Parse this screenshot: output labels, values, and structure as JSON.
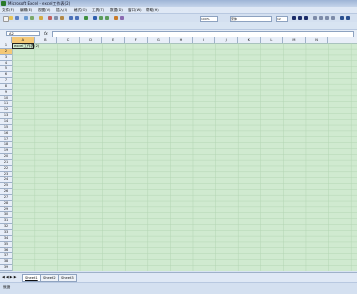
{
  "window": {
    "title": "Microsoft Excel - excel工作表(2)"
  },
  "menu": [
    "文件(F)",
    "编辑(E)",
    "视图(V)",
    "插入(I)",
    "格式(O)",
    "工具(T)",
    "数据(D)",
    "窗口(W)",
    "帮助(H)"
  ],
  "toolbar": {
    "zoom": "100%",
    "font": "宋体",
    "font_size": "12"
  },
  "formula_bar": {
    "name_box": "A2",
    "fx": "fx"
  },
  "columns": [
    "A",
    "B",
    "C",
    "D",
    "E",
    "F",
    "G",
    "H",
    "I",
    "J",
    "K",
    "L",
    "M",
    "N"
  ],
  "rows": [
    "1",
    "2",
    "3",
    "4",
    "5",
    "6",
    "7",
    "8",
    "9",
    "10",
    "11",
    "12",
    "13",
    "14",
    "15",
    "16",
    "17",
    "18",
    "19",
    "20",
    "21",
    "22",
    "23",
    "24",
    "25",
    "26",
    "27",
    "28",
    "29",
    "30",
    "31",
    "32",
    "33",
    "34",
    "35",
    "36",
    "37",
    "38",
    "39"
  ],
  "cells": {
    "A1": "excel工作表(2)"
  },
  "tabs": {
    "nav": "◀ ◀ ▶ ▶",
    "sheets": [
      "Sheet1",
      "Sheet2",
      "Sheet3"
    ],
    "active": "Sheet1"
  },
  "status": "就绪"
}
